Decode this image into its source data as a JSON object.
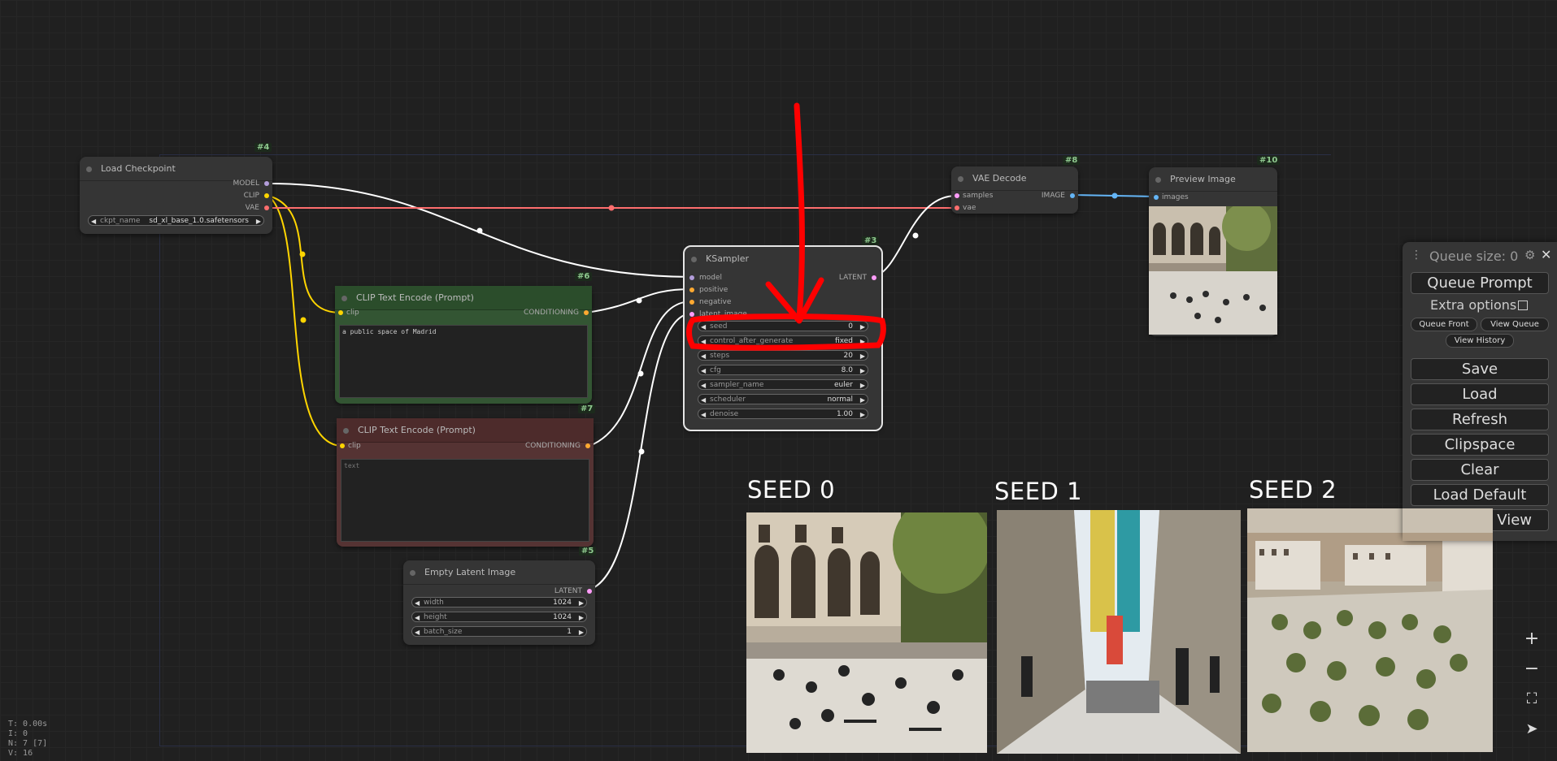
{
  "nodes": {
    "load_checkpoint": {
      "id": "#4",
      "title": "Load Checkpoint",
      "outputs": [
        "MODEL",
        "CLIP",
        "VAE"
      ],
      "widget": {
        "label": "ckpt_name",
        "value": "sd_xl_base_1.0.safetensors"
      }
    },
    "clip_pos": {
      "id": "#6",
      "title": "CLIP Text Encode (Prompt)",
      "input": "clip",
      "output": "CONDITIONING",
      "text": "a public space of Madrid"
    },
    "clip_neg": {
      "id": "#7",
      "title": "CLIP Text Encode (Prompt)",
      "input": "clip",
      "output": "CONDITIONING",
      "placeholder": "text"
    },
    "empty_latent": {
      "id": "#5",
      "title": "Empty Latent Image",
      "output": "LATENT",
      "widgets": [
        {
          "label": "width",
          "value": "1024"
        },
        {
          "label": "height",
          "value": "1024"
        },
        {
          "label": "batch_size",
          "value": "1"
        }
      ]
    },
    "ksampler": {
      "id": "#3",
      "title": "KSampler",
      "inputs": [
        "model",
        "positive",
        "negative",
        "latent_image"
      ],
      "output": "LATENT",
      "widgets": [
        {
          "label": "seed",
          "value": "0"
        },
        {
          "label": "control_after_generate",
          "value": "fixed"
        },
        {
          "label": "steps",
          "value": "20"
        },
        {
          "label": "cfg",
          "value": "8.0"
        },
        {
          "label": "sampler_name",
          "value": "euler"
        },
        {
          "label": "scheduler",
          "value": "normal"
        },
        {
          "label": "denoise",
          "value": "1.00"
        }
      ]
    },
    "vae_decode": {
      "id": "#8",
      "title": "VAE Decode",
      "inputs": [
        "samples",
        "vae"
      ],
      "output": "IMAGE"
    },
    "preview": {
      "id": "#10",
      "title": "Preview Image",
      "input": "images"
    }
  },
  "seeds": [
    "SEED 0",
    "SEED 1",
    "SEED 2"
  ],
  "menu": {
    "queue_size": "Queue size: 0",
    "queue_prompt": "Queue Prompt",
    "extra_options": "Extra options",
    "queue_front": "Queue Front",
    "view_queue": "View Queue",
    "view_history": "View History",
    "save": "Save",
    "load": "Load",
    "refresh": "Refresh",
    "clipspace": "Clipspace",
    "clear": "Clear",
    "load_default": "Load Default",
    "view": "View"
  },
  "controls": {
    "zoom_in": "+",
    "zoom_out": "−",
    "fit": "⛶",
    "arrow": "➤"
  },
  "stats": [
    "T: 0.00s",
    "I: 0",
    "N: 7 [7]",
    "V: 16"
  ],
  "colors": {
    "model": "#b39ddb",
    "clip": "#ffd500",
    "vae": "#ff6e6e",
    "conditioning": "#ffa931",
    "latent": "#ff9cf9",
    "image": "#64b5f6",
    "annotation": "#ff0000"
  }
}
